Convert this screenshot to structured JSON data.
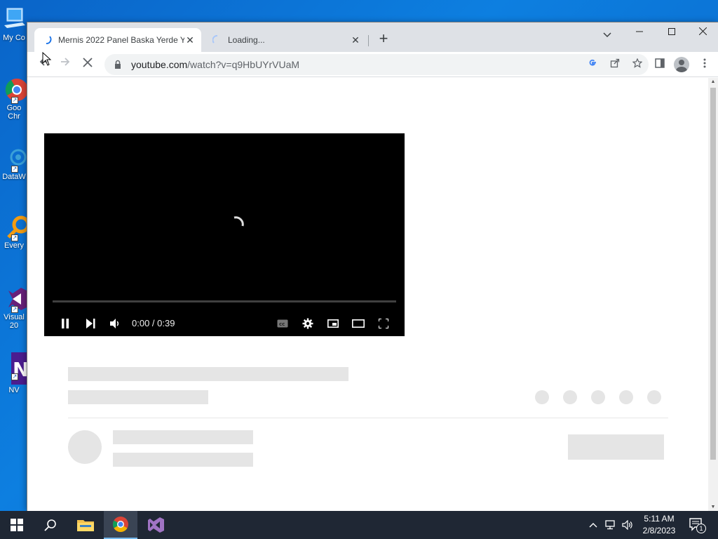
{
  "desktop": {
    "icons": [
      {
        "label": "My Co"
      },
      {
        "label": "Goo\nChr"
      },
      {
        "label": "DataW"
      },
      {
        "label": "Every"
      },
      {
        "label": "Visual\n20"
      },
      {
        "label": "NV"
      }
    ]
  },
  "browser": {
    "tabs": [
      {
        "title": "Mernis 2022 Panel Baska Yerde Y",
        "state": "active"
      },
      {
        "title": "Loading...",
        "state": "inactive"
      }
    ],
    "url_host": "youtube.com",
    "url_path": "/watch?v=q9HbUYrVUaM"
  },
  "player": {
    "time": "0:00 / 0:39",
    "progress": 0
  },
  "taskbar": {
    "clock_time": "5:11 AM",
    "clock_date": "2/8/2023",
    "notification_count": "1"
  },
  "colors": {
    "desktop_bg": "#0d7fe0",
    "taskbar_bg": "#1f2734",
    "skeleton": "#e5e5e5",
    "accent": "#1a73e8"
  }
}
